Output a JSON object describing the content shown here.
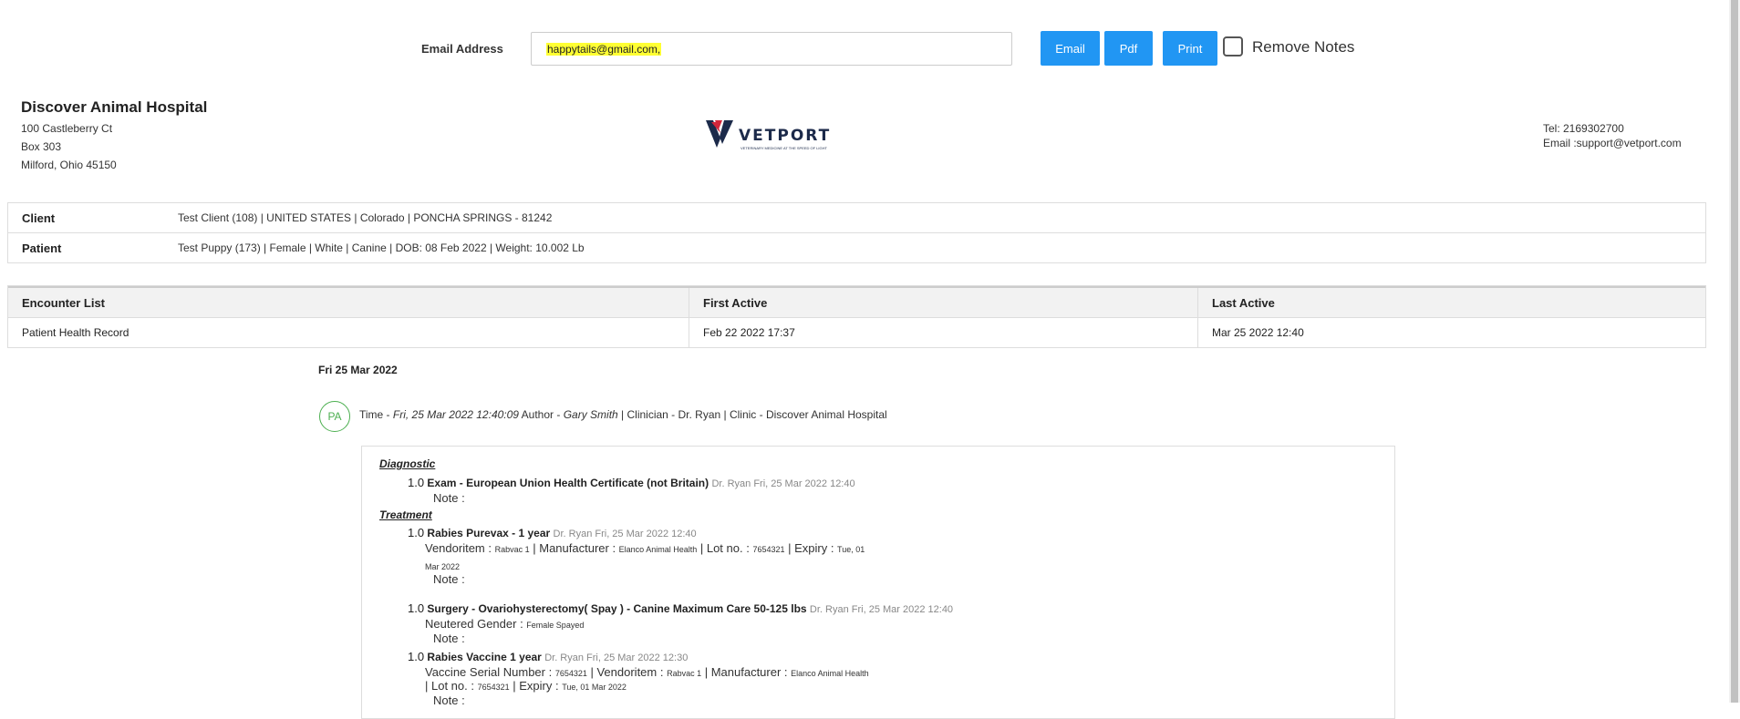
{
  "top": {
    "email_label": "Email Address",
    "email_value": "happytails@gmail.com,",
    "email_button": "Email",
    "pdf_button": "Pdf",
    "print_button": "Print",
    "remove_notes_label": "Remove Notes"
  },
  "hospital": {
    "name": "Discover Animal Hospital",
    "address_lines": [
      "100 Castleberry Ct",
      "Box 303",
      "Milford, Ohio 45150"
    ],
    "tel": "Tel: 2169302700",
    "email": "Email :support@vetport.com",
    "logo_text": "VETPORT",
    "logo_tagline": "VETERINARY MEDICINE AT THE SPEED OF LIGHT"
  },
  "info_table": [
    {
      "label": "Client",
      "value": "Test Client (108) | UNITED STATES | Colorado | PONCHA SPRINGS - 81242"
    },
    {
      "label": "Patient",
      "value": "Test Puppy (173) | Female | White | Canine | DOB: 08 Feb 2022 | Weight: 10.002 Lb"
    }
  ],
  "encounters": {
    "headers": [
      "Encounter List",
      "First Active",
      "Last Active"
    ],
    "rows": [
      [
        "Patient Health Record",
        "Feb 22 2022 17:37",
        "Mar 25 2022 12:40"
      ]
    ]
  },
  "record": {
    "date": "Fri 25 Mar 2022",
    "avatar": "PA",
    "time_label": "Time - ",
    "time_value": "Fri, 25 Mar 2022 12:40:09",
    "author_label": " Author - ",
    "author_value": "Gary Smith",
    "rest": " | Clinician - Dr. Ryan |  Clinic - Discover Animal Hospital"
  },
  "card": {
    "diagnostic_title": "Diagnostic",
    "treatment_title": "Treatment",
    "note_label": "Note :",
    "items": [
      {
        "qty": "1.0",
        "name": "Exam - European Union Health Certificate (not Britain)",
        "by": "Dr. Ryan Fri, 25 Mar 2022 12:40"
      },
      {
        "qty": "1.0",
        "name": "Rabies Purevax - 1 year",
        "by": "Dr. Ryan Fri, 25 Mar 2022 12:40"
      },
      {
        "qty": "1.0",
        "name": "Surgery - Ovariohysterectomy( Spay ) - Canine Maximum Care 50-125 lbs",
        "by": "Dr. Ryan Fri, 25 Mar 2022 12:40"
      },
      {
        "qty": "1.0",
        "name": "Rabies Vaccine 1 year",
        "by": "Dr. Ryan Fri, 25 Mar 2022 12:30"
      }
    ],
    "purevax": {
      "vendor_label": "Vendoritem : ",
      "vendor": "Rabvac 1",
      "mfr_label": " | Manufacturer : ",
      "mfr": "Elanco Animal Health",
      "lot_label": " | Lot no. : ",
      "lot": "7654321",
      "expiry_label": " | Expiry : ",
      "expiry_a": "Tue, 01",
      "expiry_b": "Mar 2022"
    },
    "surgery": {
      "gender_label": "Neutered Gender : ",
      "gender": "Female Spayed"
    },
    "vaccine": {
      "serial_label": "Vaccine Serial Number : ",
      "serial": "7654321",
      "vendor_label": " | Vendoritem : ",
      "vendor": "Rabvac 1",
      "mfr_label": " | Manufacturer : ",
      "mfr": "Elanco Animal Health",
      "lot_label": "| Lot no. : ",
      "lot": "7654321",
      "expiry_label": " | Expiry : ",
      "expiry": "Tue, 01 Mar 2022"
    }
  }
}
